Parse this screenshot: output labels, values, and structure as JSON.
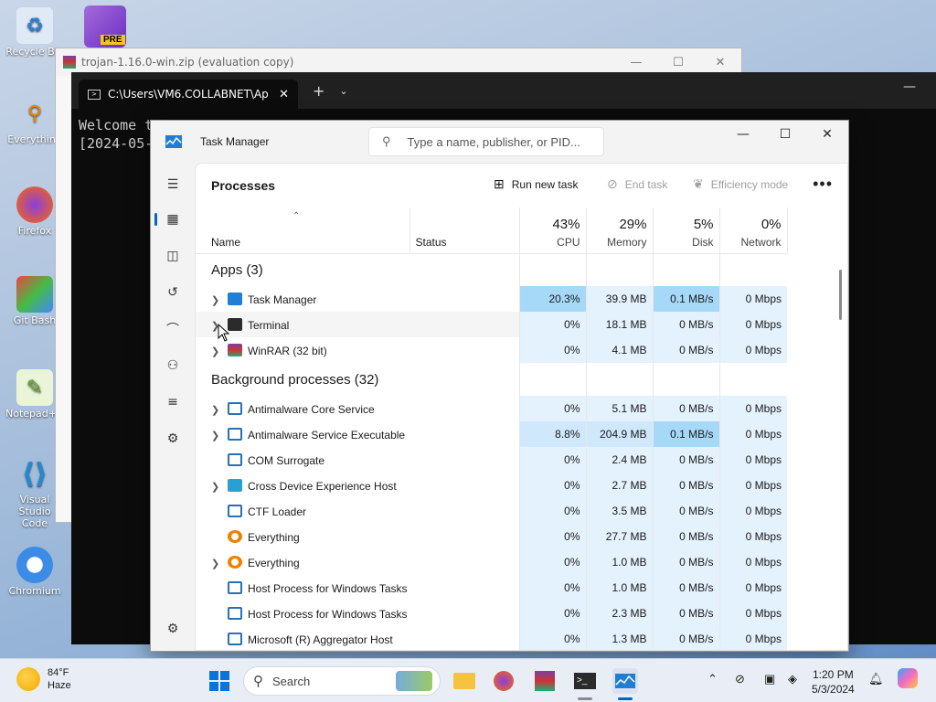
{
  "desktop": {
    "icons": [
      {
        "label": "Recycle Bin",
        "icon": "recycle-bin-icon"
      },
      {
        "label": "Everything",
        "icon": "everything-icon"
      },
      {
        "label": "Firefox",
        "icon": "firefox-icon"
      },
      {
        "label": "Git Bash",
        "icon": "git-bash-icon"
      },
      {
        "label": "Notepad++",
        "icon": "notepadpp-icon"
      },
      {
        "label": "Visual Studio Code",
        "icon": "vscode-icon"
      },
      {
        "label": "Chromium",
        "icon": "chromium-icon"
      }
    ],
    "vs_badge": "PRE"
  },
  "winrar_window": {
    "title": "trojan-1.16.0-win.zip (evaluation copy)"
  },
  "terminal": {
    "tab_title": "C:\\Users\\VM6.COLLABNET\\Ap",
    "lines": [
      "Welcome t",
      "[2024-05-"
    ]
  },
  "taskmgr": {
    "title": "Task Manager",
    "search_placeholder": "Type a name, publisher, or PID...",
    "page_title": "Processes",
    "commands": {
      "run_new_task": "Run new task",
      "end_task": "End task",
      "efficiency_mode": "Efficiency mode"
    },
    "columns": {
      "name": "Name",
      "status": "Status",
      "cpu_pct": "43%",
      "cpu": "CPU",
      "memory_pct": "29%",
      "memory": "Memory",
      "disk_pct": "5%",
      "disk": "Disk",
      "network_pct": "0%",
      "network": "Network"
    },
    "groups": [
      {
        "label": "Apps (3)",
        "rows": [
          {
            "name": "Task Manager",
            "icon": "taskmgr-icon",
            "expand": true,
            "cpu": "20.3%",
            "memory": "39.9 MB",
            "disk": "0.1 MB/s",
            "network": "0 Mbps"
          },
          {
            "name": "Terminal",
            "icon": "terminal-icon",
            "expand": true,
            "cpu": "0%",
            "memory": "18.1 MB",
            "disk": "0 MB/s",
            "network": "0 Mbps"
          },
          {
            "name": "WinRAR (32 bit)",
            "icon": "winrar-icon",
            "expand": true,
            "cpu": "0%",
            "memory": "4.1 MB",
            "disk": "0 MB/s",
            "network": "0 Mbps"
          }
        ]
      },
      {
        "label": "Background processes (32)",
        "rows": [
          {
            "name": "Antimalware Core Service",
            "icon": "service-icon",
            "expand": true,
            "cpu": "0%",
            "memory": "5.1 MB",
            "disk": "0 MB/s",
            "network": "0 Mbps"
          },
          {
            "name": "Antimalware Service Executable",
            "icon": "service-icon",
            "expand": true,
            "cpu": "8.8%",
            "memory": "204.9 MB",
            "disk": "0.1 MB/s",
            "network": "0 Mbps"
          },
          {
            "name": "COM Surrogate",
            "icon": "service-icon",
            "expand": false,
            "cpu": "0%",
            "memory": "2.4 MB",
            "disk": "0 MB/s",
            "network": "0 Mbps"
          },
          {
            "name": "Cross Device Experience Host",
            "icon": "cross-device-icon",
            "expand": true,
            "cpu": "0%",
            "memory": "2.7 MB",
            "disk": "0 MB/s",
            "network": "0 Mbps"
          },
          {
            "name": "CTF Loader",
            "icon": "service-icon",
            "expand": false,
            "cpu": "0%",
            "memory": "3.5 MB",
            "disk": "0 MB/s",
            "network": "0 Mbps"
          },
          {
            "name": "Everything",
            "icon": "everything-icon",
            "expand": false,
            "cpu": "0%",
            "memory": "27.7 MB",
            "disk": "0 MB/s",
            "network": "0 Mbps"
          },
          {
            "name": "Everything",
            "icon": "everything-icon",
            "expand": true,
            "cpu": "0%",
            "memory": "1.0 MB",
            "disk": "0 MB/s",
            "network": "0 Mbps"
          },
          {
            "name": "Host Process for Windows Tasks",
            "icon": "service-icon",
            "expand": false,
            "cpu": "0%",
            "memory": "1.0 MB",
            "disk": "0 MB/s",
            "network": "0 Mbps"
          },
          {
            "name": "Host Process for Windows Tasks",
            "icon": "service-icon",
            "expand": false,
            "cpu": "0%",
            "memory": "2.3 MB",
            "disk": "0 MB/s",
            "network": "0 Mbps"
          },
          {
            "name": "Microsoft (R) Aggregator Host",
            "icon": "service-icon",
            "expand": false,
            "cpu": "0%",
            "memory": "1.3 MB",
            "disk": "0 MB/s",
            "network": "0 Mbps"
          }
        ]
      }
    ]
  },
  "taskbar": {
    "weather_temp": "84°F",
    "weather_desc": "Haze",
    "search_label": "Search",
    "time": "1:20 PM",
    "date": "5/3/2024"
  },
  "colors": {
    "accent": "#0067c0",
    "heat_high": "#a6d8f8",
    "heat_mid": "#cfe8fb",
    "heat_low": "#e4f2fd"
  }
}
